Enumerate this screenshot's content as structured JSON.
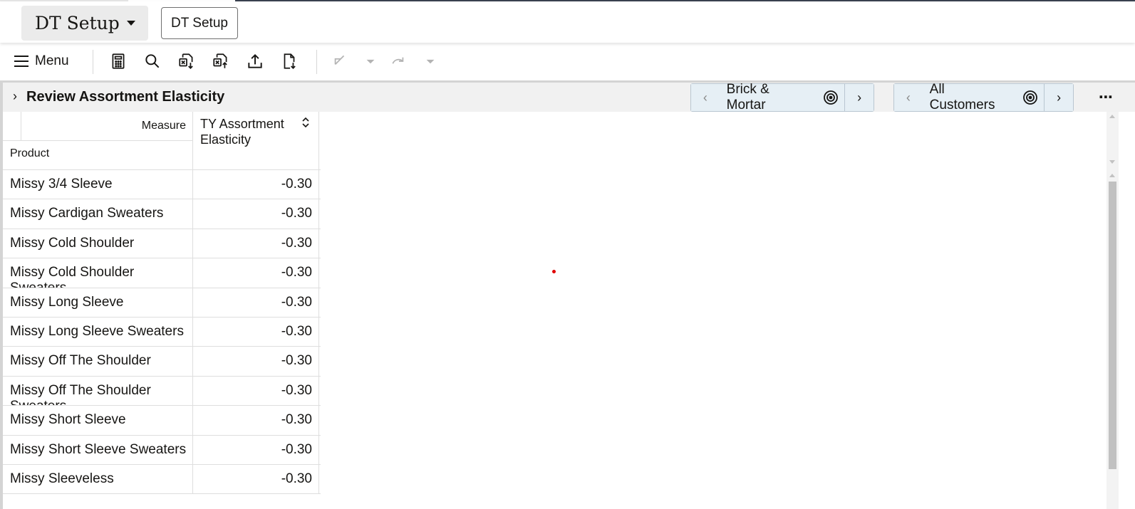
{
  "header": {
    "workspace_dropdown_label": "DT Setup",
    "workspace_button_label": "DT Setup"
  },
  "toolbar": {
    "menu_label": "Menu",
    "icons": [
      "calculator-icon",
      "search-icon",
      "export-excel-icon",
      "import-excel-icon",
      "upload-icon",
      "save-document-icon",
      "undo-icon",
      "undo-dropdown-icon",
      "redo-icon",
      "redo-dropdown-icon"
    ]
  },
  "view": {
    "title": "Review Assortment Elasticity",
    "pager1": "Brick & Mortar",
    "pager2": "All Customers"
  },
  "grid": {
    "measure_label": "Measure",
    "product_label": "Product",
    "column_header": "TY Assortment Elasticity",
    "rows": [
      {
        "product": "Missy 3/4 Sleeve",
        "value": "-0.30"
      },
      {
        "product": "Missy Cardigan Sweaters",
        "value": "-0.30"
      },
      {
        "product": "Missy Cold Shoulder",
        "value": "-0.30"
      },
      {
        "product": "Missy Cold Shoulder Sweaters",
        "value": "-0.30"
      },
      {
        "product": "Missy Long Sleeve",
        "value": "-0.30"
      },
      {
        "product": "Missy Long Sleeve Sweaters",
        "value": "-0.30"
      },
      {
        "product": "Missy Off The Shoulder",
        "value": "-0.30"
      },
      {
        "product": "Missy Off The Shoulder Sweaters",
        "value": "-0.30"
      },
      {
        "product": "Missy Short Sleeve",
        "value": "-0.30"
      },
      {
        "product": "Missy Short Sleeve Sweaters",
        "value": "-0.30"
      },
      {
        "product": "Missy Sleeveless",
        "value": "-0.30"
      }
    ]
  },
  "colors": {
    "pager_bg": "#e6eff5",
    "accent_red": "#e00000"
  }
}
